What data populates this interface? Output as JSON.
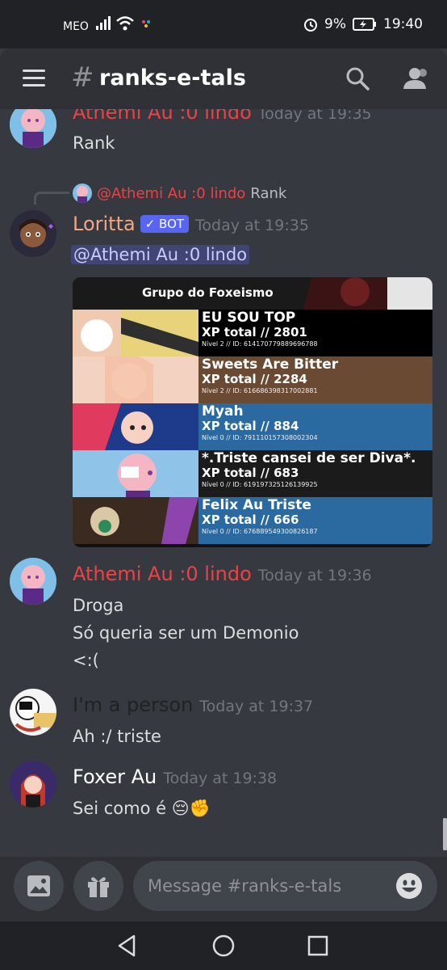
{
  "status_bar": {
    "carrier": "MEO",
    "battery": "9%",
    "time": "19:40"
  },
  "header": {
    "channel_name": "ranks-e-tals"
  },
  "messages": [
    {
      "author": "Athemi Au :0 lindo",
      "author_color": "#ed4245",
      "timestamp": "Today at 19:35",
      "lines": [
        "Rank"
      ]
    },
    {
      "author": "Loritta",
      "author_color": "#f3a683",
      "badge": "✓ BOT",
      "timestamp": "Today at 19:35",
      "reply": {
        "mention": "@Athemi Au :0 lindo",
        "text": "Rank"
      },
      "mention": "@Athemi Au :0 lindo",
      "rank_card": {
        "title": "Grupo do Foxeismo",
        "entries": [
          {
            "name": "EU SOU TOP",
            "xp": "XP total // 2801",
            "id": "Nível 2 // ID: 614170779889696788"
          },
          {
            "name": "Sweets Are Bitter",
            "xp": "XP total // 2284",
            "id": "Nível 2 // ID: 616686398317002881"
          },
          {
            "name": "Myah",
            "xp": "XP total // 884",
            "id": "Nível 0 // ID: 791110157308002304"
          },
          {
            "name": "*.Triste cansei de ser Diva*.",
            "xp": "XP total // 683",
            "id": "Nível 0 // ID: 619197325126139925"
          },
          {
            "name": "Felix Au Triste",
            "xp": "XP total // 666",
            "id": "Nível 0 // ID: 676889549300826187"
          }
        ]
      }
    },
    {
      "author": "Athemi Au :0 lindo",
      "author_color": "#ed4245",
      "timestamp": "Today at 19:36",
      "lines": [
        "Droga",
        "Só queria ser um Demonio",
        "<:("
      ]
    },
    {
      "author": "I'm a person",
      "author_color": "#202225",
      "timestamp": "Today at 19:37",
      "lines": [
        "Ah :/ triste"
      ]
    },
    {
      "author": "Foxer Au",
      "author_color": "#ffffff",
      "timestamp": "Today at 19:38",
      "lines": [
        "Sei como é 😔✊"
      ]
    }
  ],
  "composer": {
    "placeholder": "Message #ranks-e-tals"
  },
  "icons": [
    "menu-icon",
    "hash-icon",
    "search-icon",
    "members-icon",
    "image-icon",
    "gift-icon",
    "emoji-icon",
    "back-icon",
    "home-icon",
    "recents-icon"
  ]
}
